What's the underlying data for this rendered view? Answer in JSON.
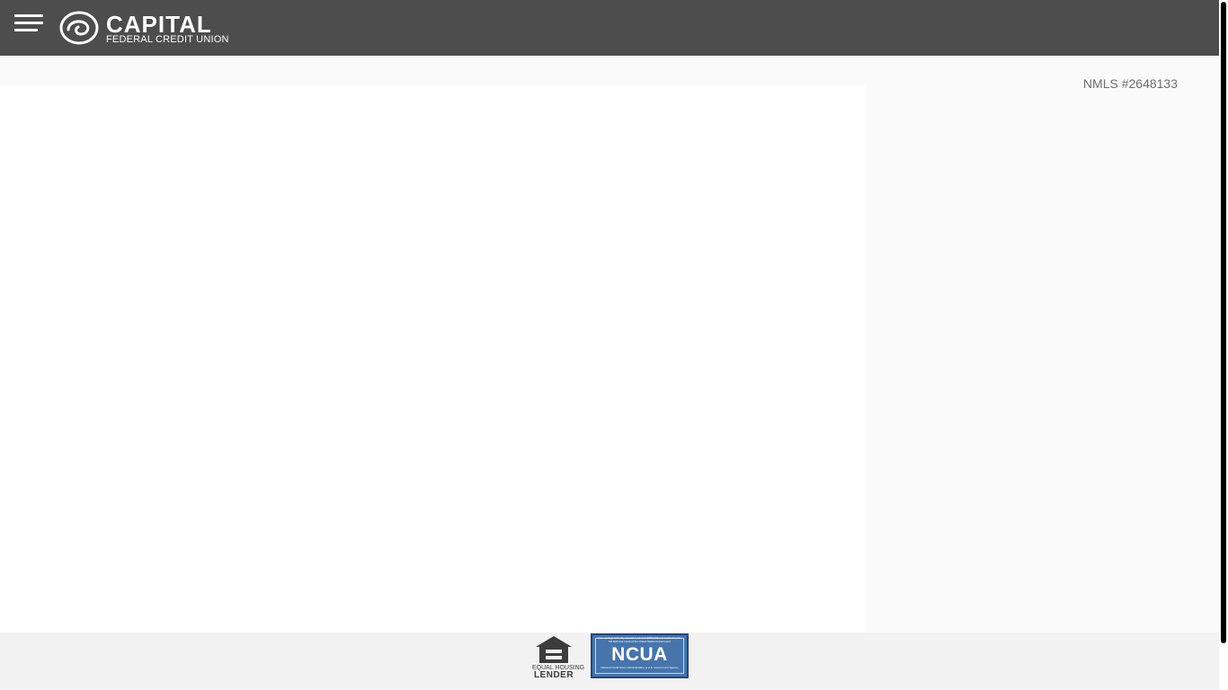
{
  "header": {
    "menu_icon": "hamburger-menu-icon",
    "logo": {
      "name": "CAPITAL",
      "subtitle": "FEDERAL CREDIT UNION"
    }
  },
  "sidebar": {
    "nmls": "NMLS #2648133"
  },
  "footer": {
    "equal_housing": {
      "icon": "equal-housing-icon",
      "line1": "EQUAL HOUSING",
      "line2": "LENDER"
    },
    "ncua": {
      "top_text": "Your savings federally insured to at least $250,000 and backed by the full faith and credit of the United States Government",
      "name": "NCUA",
      "bottom_text": "National Credit Union Administration, a U.S. Government Agency"
    }
  },
  "colors": {
    "header_bg": "#4d4d4d",
    "panel_bg": "#fafafa",
    "footer_bg": "#f2f2f2",
    "ncua_blue": "#4674ab"
  }
}
